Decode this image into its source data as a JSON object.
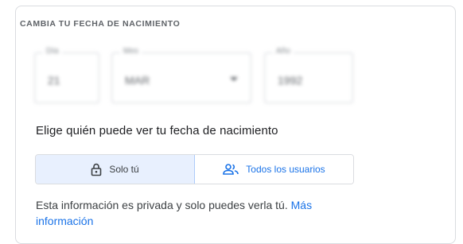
{
  "section": {
    "title": "CAMBIA TU FECHA DE NACIMIENTO"
  },
  "date_fields": {
    "day": {
      "label": "Día",
      "value": "21"
    },
    "month": {
      "label": "Mes",
      "value": "MAR"
    },
    "year": {
      "label": "Año",
      "value": "1992"
    }
  },
  "visibility": {
    "heading": "Elige quién puede ver tu fecha de nacimiento",
    "options": [
      {
        "label": "Solo tú",
        "icon": "lock-icon",
        "selected": true
      },
      {
        "label": "Todos los usuarios",
        "icon": "people-icon",
        "selected": false
      }
    ],
    "info_text": "Esta información es privada y solo puedes verla tú.",
    "info_link": "Más información"
  },
  "colors": {
    "accent": "#1a73e8",
    "selected_bg": "#e8f0fe",
    "border": "#dadce0",
    "text": "#202124"
  }
}
